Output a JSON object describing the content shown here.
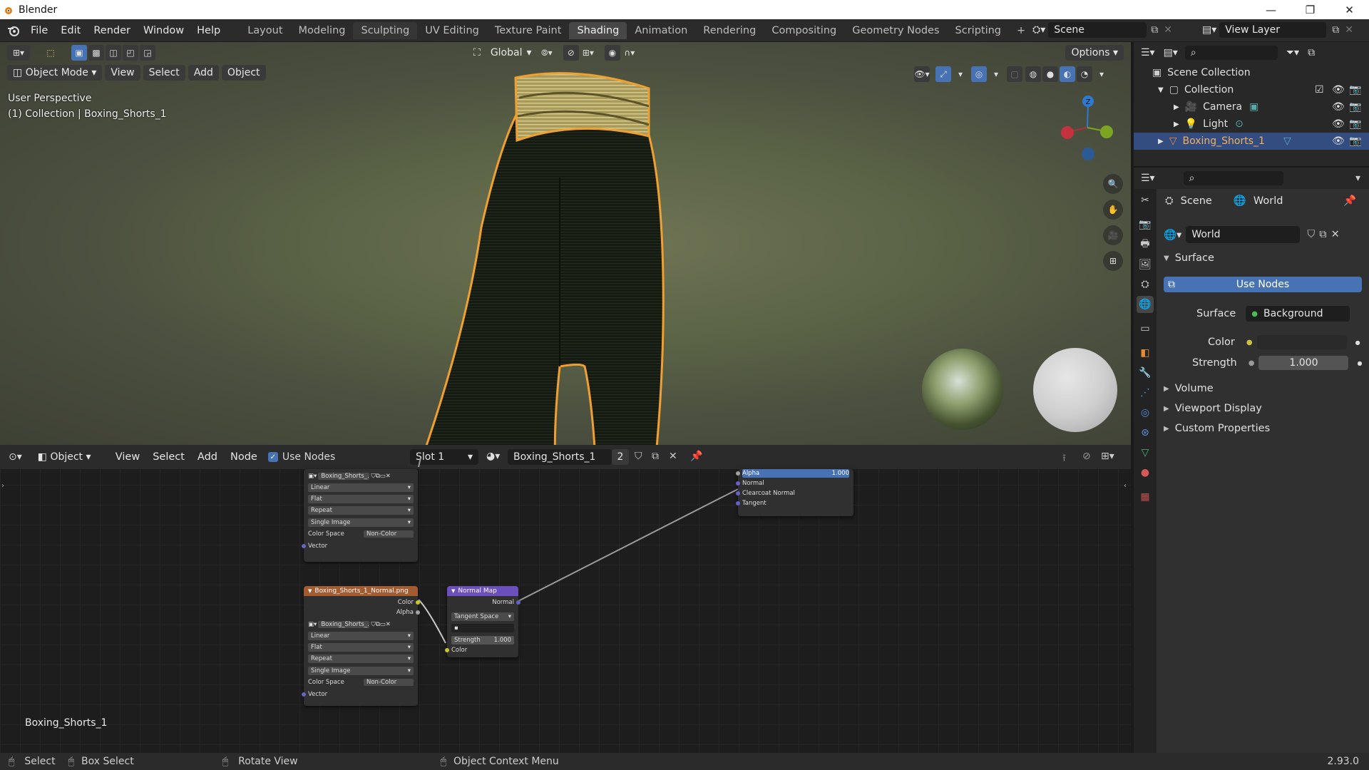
{
  "window": {
    "title": "Blender",
    "minimize": "—",
    "maximize": "❐",
    "close": "✕"
  },
  "menu": [
    "File",
    "Edit",
    "Render",
    "Window",
    "Help"
  ],
  "workspaces": [
    "Layout",
    "Modeling",
    "Sculpting",
    "UV Editing",
    "Texture Paint",
    "Shading",
    "Animation",
    "Rendering",
    "Compositing",
    "Geometry Nodes",
    "Scripting"
  ],
  "active_workspace": "Shading",
  "add_workspace": "+",
  "scene_name": "Scene",
  "view_layer_name": "View Layer",
  "toolbar": {
    "orientation": "Global",
    "options": "Options"
  },
  "viewport": {
    "mode": "Object Mode",
    "menus": [
      "View",
      "Select",
      "Add",
      "Object"
    ],
    "perspective": "User Perspective",
    "collection_info": "(1) Collection | Boxing_Shorts_1",
    "gizmo_z": "Z"
  },
  "outliner": {
    "root": "Scene Collection",
    "collection": "Collection",
    "items": [
      {
        "name": "Camera"
      },
      {
        "name": "Light"
      },
      {
        "name": "Boxing_Shorts_1",
        "selected": true
      }
    ]
  },
  "properties": {
    "breadcrumb_scene": "Scene",
    "breadcrumb_world": "World",
    "world_name": "World",
    "surface_panel": "Surface",
    "use_nodes": "Use Nodes",
    "surface_label": "Surface",
    "surface_value": "Background",
    "color_label": "Color",
    "strength_label": "Strength",
    "strength_value": "1.000",
    "collapsed_panels": [
      "Volume",
      "Viewport Display",
      "Custom Properties"
    ]
  },
  "node_editor": {
    "object_type": "Object",
    "menus": [
      "View",
      "Select",
      "Add",
      "Node"
    ],
    "use_nodes": "Use Nodes",
    "slot": "Slot 1",
    "material": "Boxing_Shorts_1",
    "users": "2",
    "footer_label": "Boxing_Shorts_1",
    "image_node_1": {
      "image": "Boxing_Shorts_...",
      "interpolation": "Linear",
      "projection": "Flat",
      "extension": "Repeat",
      "source": "Single Image",
      "color_space_label": "Color Space",
      "color_space": "Non-Color",
      "vector": "Vector"
    },
    "image_node_2": {
      "title": "Boxing_Shorts_1_Normal.png",
      "out_color": "Color",
      "out_alpha": "Alpha",
      "image": "Boxing_Shorts_...",
      "interpolation": "Linear",
      "projection": "Flat",
      "extension": "Repeat",
      "source": "Single Image",
      "color_space_label": "Color Space",
      "color_space": "Non-Color",
      "vector": "Vector"
    },
    "normal_map_node": {
      "title": "Normal Map",
      "out_normal": "Normal",
      "space": "Tangent Space",
      "strength_label": "Strength",
      "strength_value": "1.000",
      "in_color": "Color"
    },
    "bsdf_partial": {
      "alpha_label": "Alpha",
      "alpha_value": "1.000",
      "inputs": [
        "Normal",
        "Clearcoat Normal",
        "Tangent"
      ],
      "top_socket": "Alpha"
    }
  },
  "statusbar": {
    "select": "Select",
    "box_select": "Box Select",
    "rotate": "Rotate View",
    "context": "Object Context Menu",
    "version": "2.93.0"
  }
}
